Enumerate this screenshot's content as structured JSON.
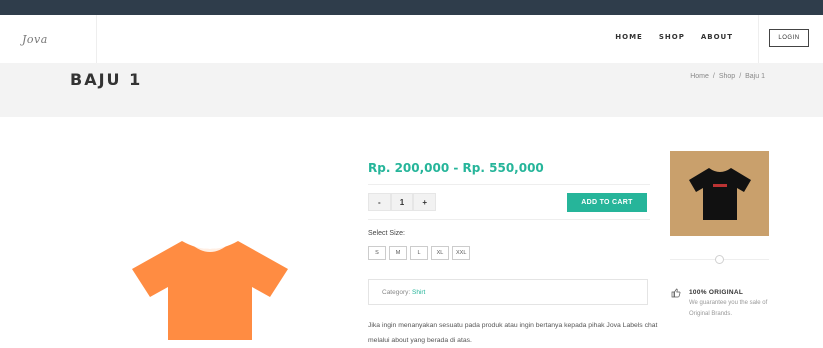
{
  "header": {
    "logo_text": "Jova",
    "nav": [
      "HOME",
      "SHOP",
      "ABOUT"
    ],
    "login_label": "LOGIN"
  },
  "titlebar": {
    "title": "BAJU 1",
    "breadcrumb": [
      "Home",
      "/",
      "Shop",
      "/",
      "Baju 1"
    ]
  },
  "product": {
    "price": "Rp. 200,000 - Rp. 550,000",
    "qty": {
      "minus": "-",
      "value": "1",
      "plus": "+"
    },
    "add_to_cart": "ADD TO CART",
    "size_label": "Select Size:",
    "sizes": [
      "S",
      "M",
      "L",
      "XL",
      "XXL"
    ],
    "category_prefix": "Category:",
    "category_link": "Shirt",
    "description": "Jika ingin menanyakan sesuatu pada produk atau ingin bertanya kepada pihak Jova Labels chat melalui about yang berada di atas."
  },
  "sidebar": {
    "original_title": "100% ORIGINAL",
    "original_sub": "We guarantee you the sale of Original Brands."
  },
  "colors": {
    "accent": "#26b59a",
    "tshirt": "#ff8c42",
    "topbar": "#2f3d4b",
    "thumb_bg": "#c9a06c"
  }
}
